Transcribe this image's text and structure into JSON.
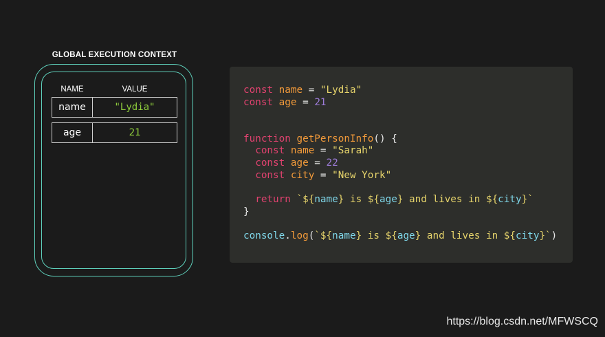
{
  "context": {
    "title": "GLOBAL EXECUTION CONTEXT",
    "columns": {
      "name": "NAME",
      "value": "VALUE"
    },
    "variables": [
      {
        "name": "name",
        "value": "\"Lydia\""
      },
      {
        "name": "age",
        "value": "21"
      }
    ],
    "border_color": "#5fd2bd"
  },
  "code": {
    "colors": {
      "keyword": "#e0426f",
      "identifier": "#f29a3a",
      "string": "#e5d36b",
      "number": "#9d7cd8",
      "builtin": "#7fd6e8",
      "plain": "#e6e6e6",
      "background": "#2d2e2b"
    },
    "lines": [
      [
        [
          "kw",
          "const "
        ],
        [
          "id",
          "name"
        ],
        [
          "pl",
          " = "
        ],
        [
          "str",
          "\"Lydia\""
        ]
      ],
      [
        [
          "kw",
          "const "
        ],
        [
          "id",
          "age"
        ],
        [
          "pl",
          " = "
        ],
        [
          "num",
          "21"
        ]
      ],
      [],
      [],
      [
        [
          "kw",
          "function "
        ],
        [
          "id",
          "getPersonInfo"
        ],
        [
          "pl",
          "() {"
        ]
      ],
      [
        [
          "pl",
          "  "
        ],
        [
          "kw",
          "const "
        ],
        [
          "id",
          "name"
        ],
        [
          "pl",
          " = "
        ],
        [
          "str",
          "\"Sarah\""
        ]
      ],
      [
        [
          "pl",
          "  "
        ],
        [
          "kw",
          "const "
        ],
        [
          "id",
          "age"
        ],
        [
          "pl",
          " = "
        ],
        [
          "num",
          "22"
        ]
      ],
      [
        [
          "pl",
          "  "
        ],
        [
          "kw",
          "const "
        ],
        [
          "id",
          "city"
        ],
        [
          "pl",
          " = "
        ],
        [
          "str",
          "\"New York\""
        ]
      ],
      [],
      [
        [
          "pl",
          "  "
        ],
        [
          "kw",
          "return "
        ],
        [
          "str",
          "`${"
        ],
        [
          "bi",
          "name"
        ],
        [
          "str",
          "} is ${"
        ],
        [
          "bi",
          "age"
        ],
        [
          "str",
          "} and lives in ${"
        ],
        [
          "bi",
          "city"
        ],
        [
          "str",
          "}`"
        ]
      ],
      [
        [
          "pl",
          "}"
        ]
      ],
      [],
      [
        [
          "bi",
          "console"
        ],
        [
          "pl",
          "."
        ],
        [
          "id",
          "log"
        ],
        [
          "pl",
          "("
        ],
        [
          "str",
          "`${"
        ],
        [
          "bi",
          "name"
        ],
        [
          "str",
          "} is ${"
        ],
        [
          "bi",
          "age"
        ],
        [
          "str",
          "} and lives in ${"
        ],
        [
          "bi",
          "city"
        ],
        [
          "str",
          "}`"
        ],
        [
          "pl",
          ")"
        ]
      ]
    ]
  },
  "watermark": "https://blog.csdn.net/MFWSCQ"
}
